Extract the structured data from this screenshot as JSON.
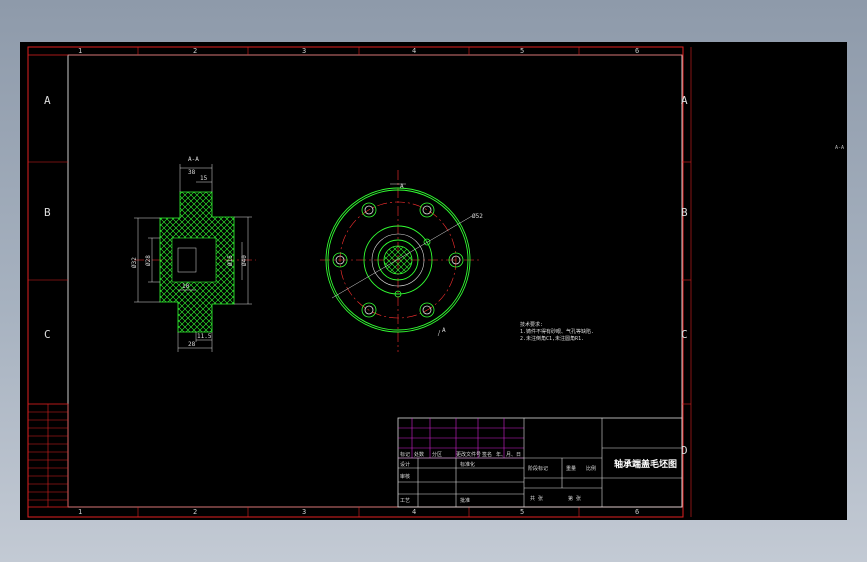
{
  "frame": {
    "columns": [
      "1",
      "2",
      "3",
      "4",
      "5",
      "6"
    ],
    "rows": [
      "A",
      "B",
      "C",
      "D"
    ]
  },
  "section_view": {
    "section_label": "A-A",
    "dims": {
      "top_width": "38",
      "top_inner": "15",
      "dia_left_outer": "Ø32",
      "dia_left_inner": "Ø28",
      "dia_right_a": "Ø15",
      "dia_right_b": "Ø40",
      "inner_len": "10",
      "bottom_len": "11.5",
      "bottom_total": "28"
    }
  },
  "front_view": {
    "pcd_label": "Ø52",
    "section_mark_top": "A",
    "section_mark_bottom": "A"
  },
  "notes": {
    "title": "技术要求:",
    "line1": "1.铸件不得有砂眼、气孔等缺陷.",
    "line2": "2.未注倒角C1,未注圆角R1."
  },
  "title_block": {
    "drawing_title": "轴承端盖毛坯图",
    "header_row": [
      "标记",
      "处数",
      "分区",
      "更改文件号",
      "签名",
      "年、月、日"
    ],
    "rows": [
      {
        "label": "设计",
        "mid": "标准化"
      },
      {
        "label": "审核",
        "mid": ""
      },
      {
        "label": "工艺",
        "mid": "批准"
      }
    ],
    "stage_labels": [
      "阶段标记",
      "重量",
      "比例"
    ],
    "sheet_labels": [
      "共 张",
      "第 张"
    ]
  },
  "stray_text": "A-A",
  "colors": {
    "frame": "#e02020",
    "outline": "#ffffff",
    "part": "#33ff33",
    "center": "#ff3030",
    "title_grid": "#d020d0"
  }
}
